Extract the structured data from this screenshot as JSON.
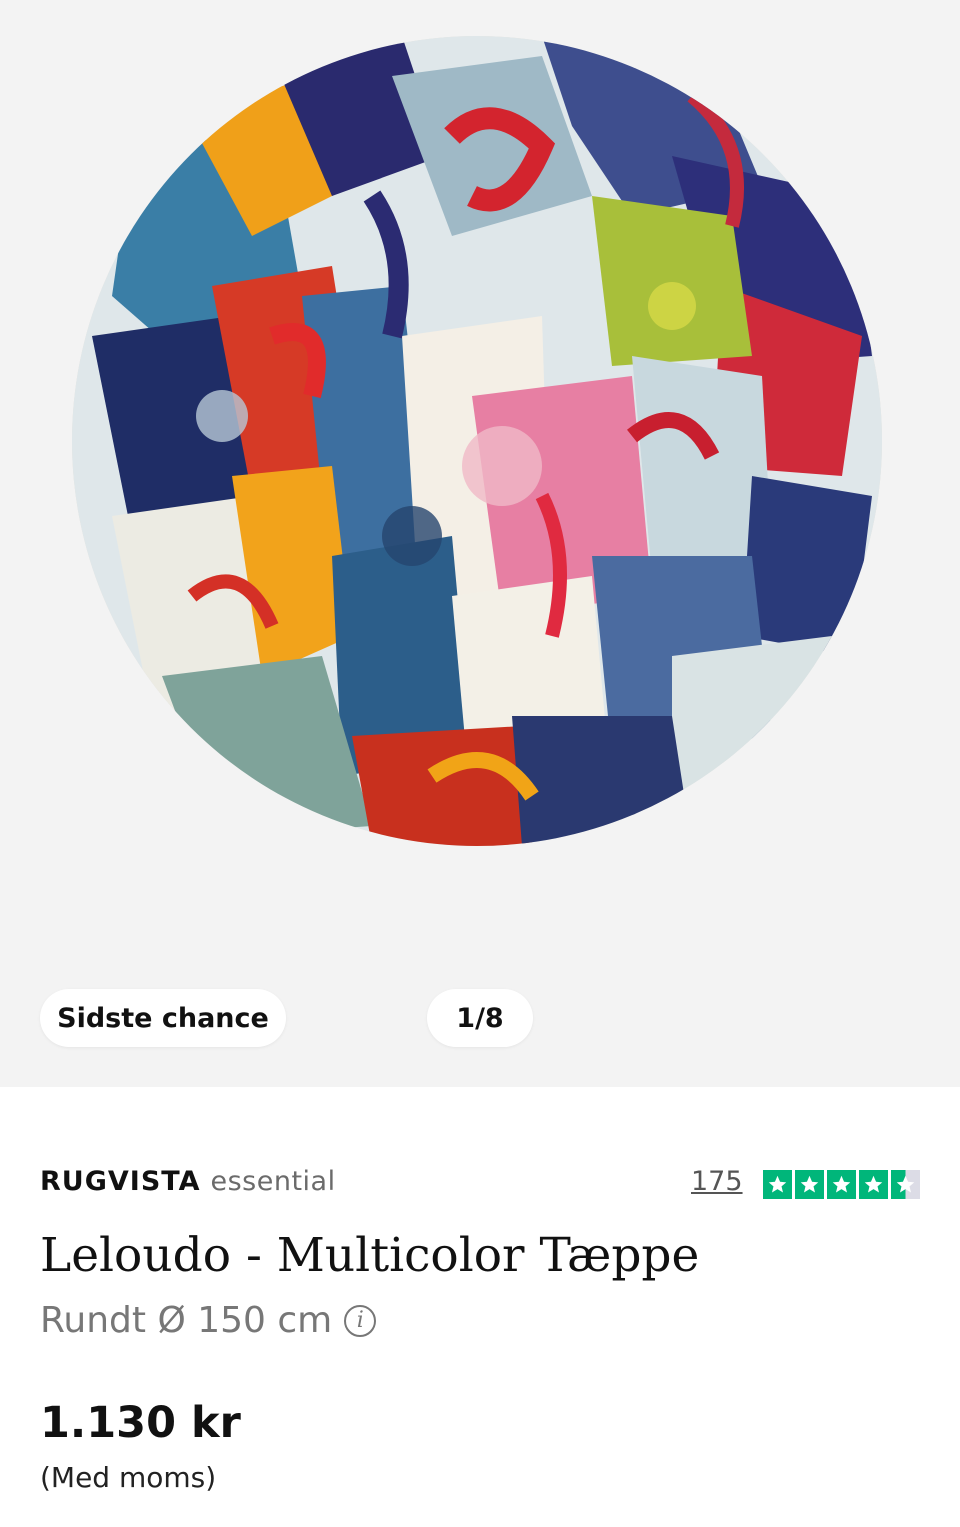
{
  "gallery": {
    "badge_label": "Sidste chance",
    "counter_label": "1/8",
    "image_alt": "rug-image"
  },
  "product": {
    "brand_strong": "RUGVISTA",
    "brand_light": "essential",
    "review_count": "175",
    "rating_stars": 4.5,
    "title": "Leloudo - Multicolor Tæppe",
    "size_label": "Rundt Ø 150 cm",
    "info_icon": "i",
    "price": "1.130 kr",
    "vat_note": "(Med moms)"
  },
  "colors": {
    "gallery_bg": "#f3f3f3",
    "trustpilot_green": "#00b67a",
    "text_dark": "#111111",
    "text_muted": "#777777"
  }
}
